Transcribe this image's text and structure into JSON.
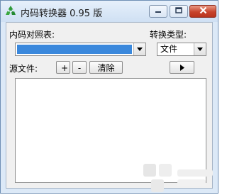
{
  "window": {
    "title": "内码转换器 0.95 版"
  },
  "form": {
    "table_label": "内码对照表:",
    "table_value": "",
    "convert_type_label": "转换类型:",
    "convert_type_value": "文件",
    "source_files_label": "源文件:",
    "add_label": "+",
    "remove_label": "-",
    "clear_label": "清除",
    "files": []
  },
  "icons": {
    "app": "recycle-icon",
    "minimize": "minimize-icon",
    "maximize": "maximize-icon",
    "close": "close-icon",
    "start": "play-icon",
    "dropdown": "chevron-down-icon"
  },
  "colors": {
    "selection": "#3a88dc",
    "close_button": "#c8442b"
  }
}
